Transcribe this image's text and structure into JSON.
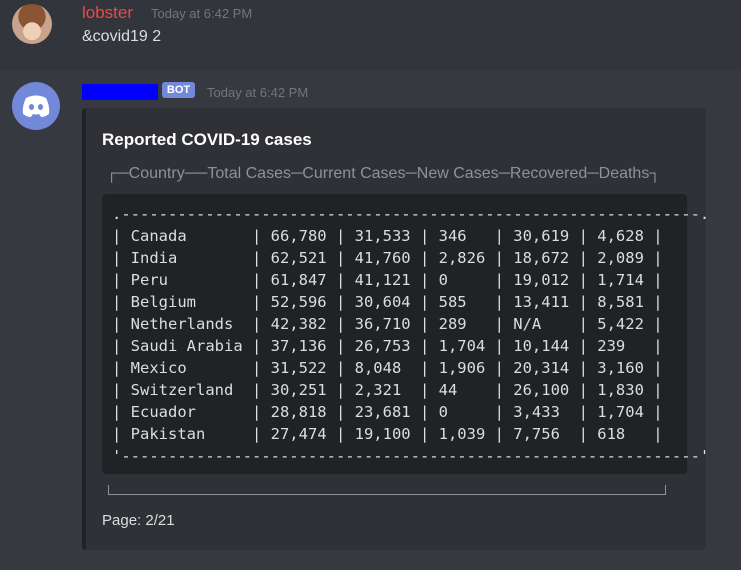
{
  "message1": {
    "author": "lobster",
    "timestamp": "Today at 6:42 PM",
    "content": "&covid19 2"
  },
  "message2": {
    "bot_tag": "BOT",
    "timestamp": "Today at 6:42 PM"
  },
  "embed": {
    "title": "Reported COVID-19 cases",
    "header_line": "┌─Country──Total Cases─Current Cases─New Cases─Recovered─Deaths┐",
    "table": {
      "columns": [
        "Country",
        "Total Cases",
        "Current Cases",
        "New Cases",
        "Recovered",
        "Deaths"
      ],
      "rows": [
        [
          "Canada",
          "66,780",
          "31,533",
          "346",
          "30,619",
          "4,628"
        ],
        [
          "India",
          "62,521",
          "41,760",
          "2,826",
          "18,672",
          "2,089"
        ],
        [
          "Peru",
          "61,847",
          "41,121",
          "0",
          "19,012",
          "1,714"
        ],
        [
          "Belgium",
          "52,596",
          "30,604",
          "585",
          "13,411",
          "8,581"
        ],
        [
          "Netherlands",
          "42,382",
          "36,710",
          "289",
          "N/A",
          "5,422"
        ],
        [
          "Saudi Arabia",
          "37,136",
          "26,753",
          "1,704",
          "10,144",
          "239"
        ],
        [
          "Mexico",
          "31,522",
          "8,048",
          "1,906",
          "20,314",
          "3,160"
        ],
        [
          "Switzerland",
          "30,251",
          "2,321",
          "44",
          "26,100",
          "1,830"
        ],
        [
          "Ecuador",
          "28,818",
          "23,681",
          "0",
          "3,433",
          "1,704"
        ],
        [
          "Pakistan",
          "27,474",
          "19,100",
          "1,039",
          "7,756",
          "618"
        ]
      ]
    },
    "footer": "Page: 2/21"
  }
}
